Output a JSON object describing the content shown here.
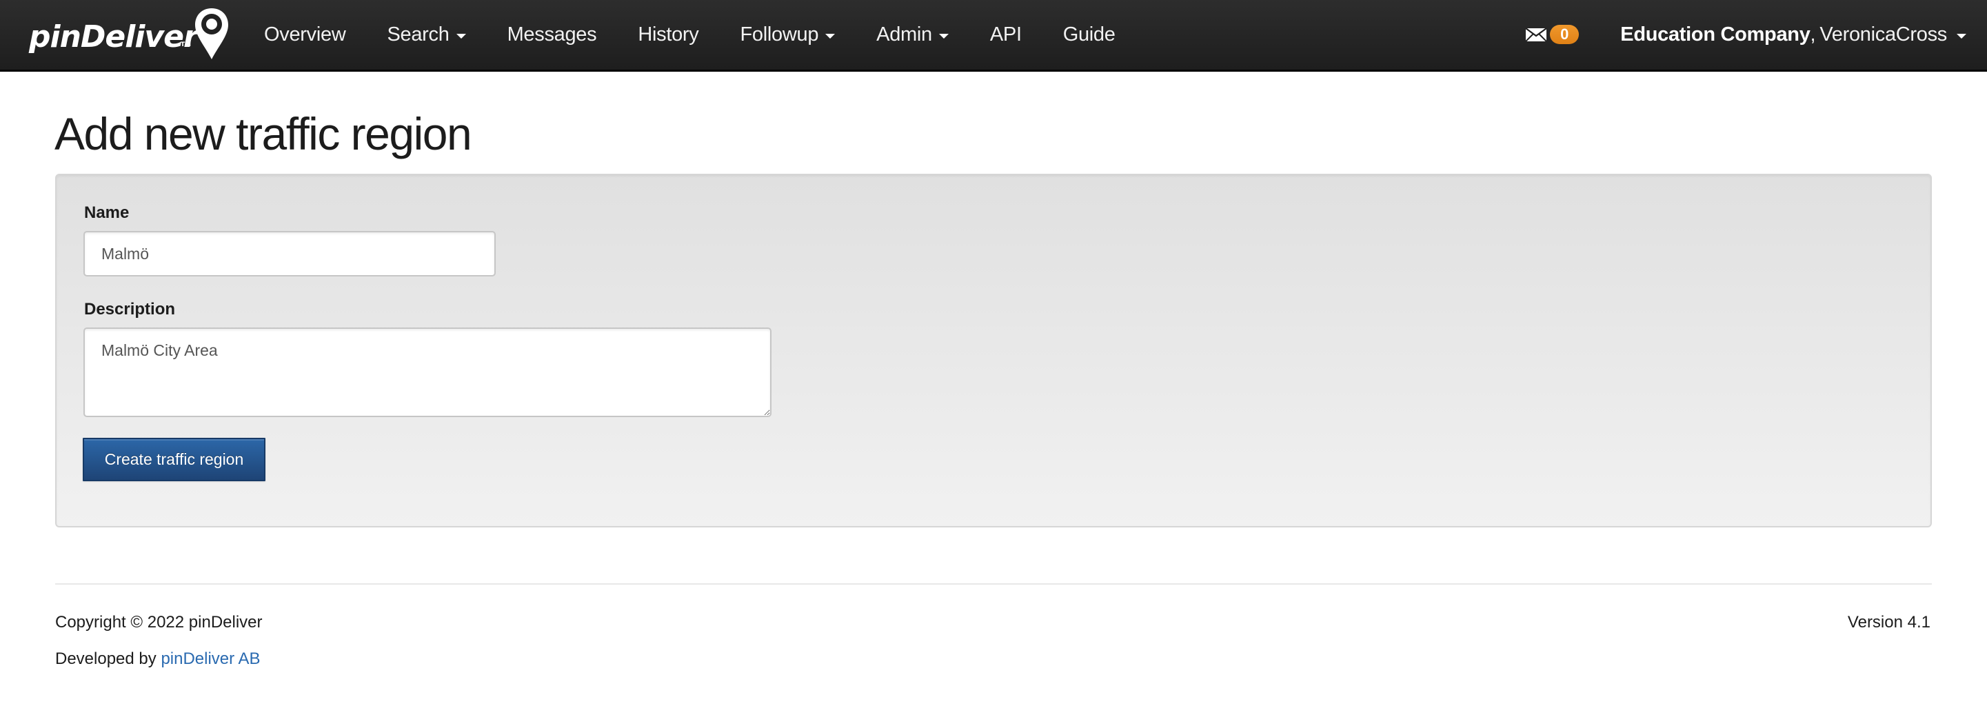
{
  "brand": {
    "name": "pinDeliver",
    "trademark": "TM",
    "logo_icon": "map-pin-icon"
  },
  "nav": {
    "items": [
      {
        "label": "Overview",
        "dropdown": false
      },
      {
        "label": "Search",
        "dropdown": true
      },
      {
        "label": "Messages",
        "dropdown": false
      },
      {
        "label": "History",
        "dropdown": false
      },
      {
        "label": "Followup",
        "dropdown": true
      },
      {
        "label": "Admin",
        "dropdown": true
      },
      {
        "label": "API",
        "dropdown": false
      },
      {
        "label": "Guide",
        "dropdown": false
      }
    ],
    "messages": {
      "icon": "envelope-icon",
      "unread_count": "0",
      "badge_color": "#e8891f"
    },
    "user": {
      "company": "Education Company",
      "separator": ",",
      "username": "VeronicaCross"
    }
  },
  "page": {
    "title": "Add new traffic region"
  },
  "form": {
    "name_label": "Name",
    "name_value": "Malmö",
    "description_label": "Description",
    "description_value": "Malmö City Area",
    "submit_label": "Create traffic region",
    "submit_color": "#245796"
  },
  "footer": {
    "copyright": "Copyright © 2022 pinDeliver",
    "developed_prefix": "Developed by ",
    "developer_link": "pinDeliver AB",
    "link_color": "#2a6ab0",
    "version": "Version 4.1"
  }
}
